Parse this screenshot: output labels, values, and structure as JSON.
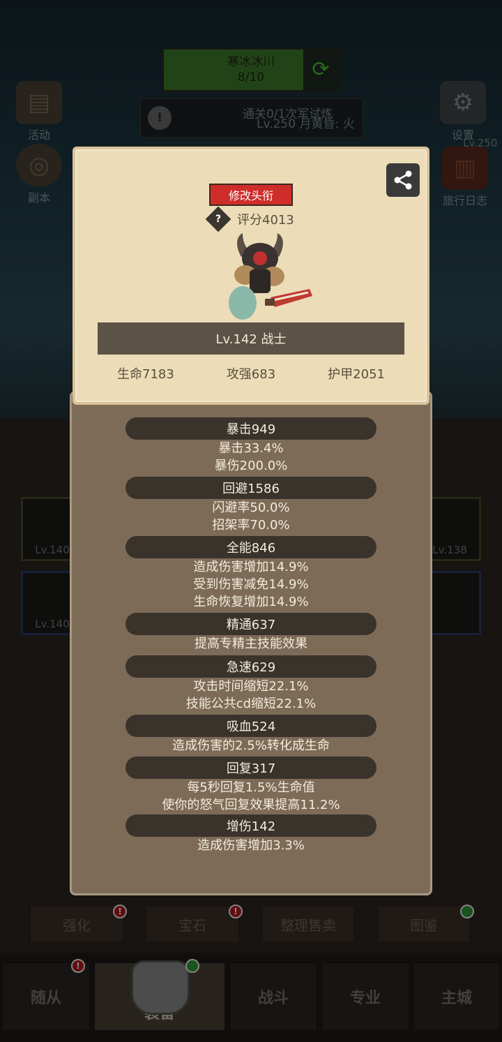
{
  "background": {
    "zone_name": "寒冰冰川",
    "zone_progress": "8/10",
    "quest_line1": "通关0/1次军试炼",
    "quest_line2": "Lv.250 月黄昏: 火",
    "left_icons": [
      {
        "label": "活动",
        "icon": "book-icon"
      },
      {
        "label": "副本",
        "icon": "portal-icon"
      }
    ],
    "right_icons": [
      {
        "label": "设置",
        "icon": "gear-icon"
      },
      {
        "label": "旅行日志",
        "icon": "journal-icon"
      }
    ],
    "right_level": "Lv.250",
    "slots": [
      {
        "level": "Lv.140"
      },
      {
        "level": "Lv.140"
      },
      {
        "level": "Lv.138"
      }
    ],
    "func_buttons": [
      "强化",
      "宝石",
      "整理售卖",
      "图鉴"
    ],
    "tabs": [
      "随从",
      "装备",
      "战斗",
      "专业",
      "主城"
    ],
    "active_tab": "装备"
  },
  "modal": {
    "change_title_label": "修改头衔",
    "score": "评分4013",
    "score_help": "?",
    "hero_name": "Lv.142 战士",
    "base_stats": {
      "hp": "生命7183",
      "attack": "攻强683",
      "armor": "护甲2051"
    },
    "stat_groups": [
      {
        "title": "暴击949",
        "lines": [
          "暴击33.4%",
          "暴伤200.0%"
        ]
      },
      {
        "title": "回避1586",
        "lines": [
          "闪避率50.0%",
          "招架率70.0%"
        ]
      },
      {
        "title": "全能846",
        "lines": [
          "造成伤害增加14.9%",
          "受到伤害减免14.9%",
          "生命恢复增加14.9%"
        ]
      },
      {
        "title": "精通637",
        "lines": [
          "提高专精主技能效果"
        ]
      },
      {
        "title": "急速629",
        "lines": [
          "攻击时间缩短22.1%",
          "技能公共cd缩短22.1%"
        ]
      },
      {
        "title": "吸血524",
        "lines": [
          "造成伤害的2.5%转化成生命"
        ]
      },
      {
        "title": "回复317",
        "lines": [
          "每5秒回复1.5%生命值",
          "使你的怒气回复效果提高11.2%"
        ]
      },
      {
        "title": "增伤142",
        "lines": [
          "造成伤害增加3.3%"
        ]
      }
    ]
  },
  "colors": {
    "panel_light": "#ecdcb8",
    "panel_dark": "#7d6b58",
    "band_dark": "#3a332c",
    "accent_red": "#cf2d2a"
  }
}
